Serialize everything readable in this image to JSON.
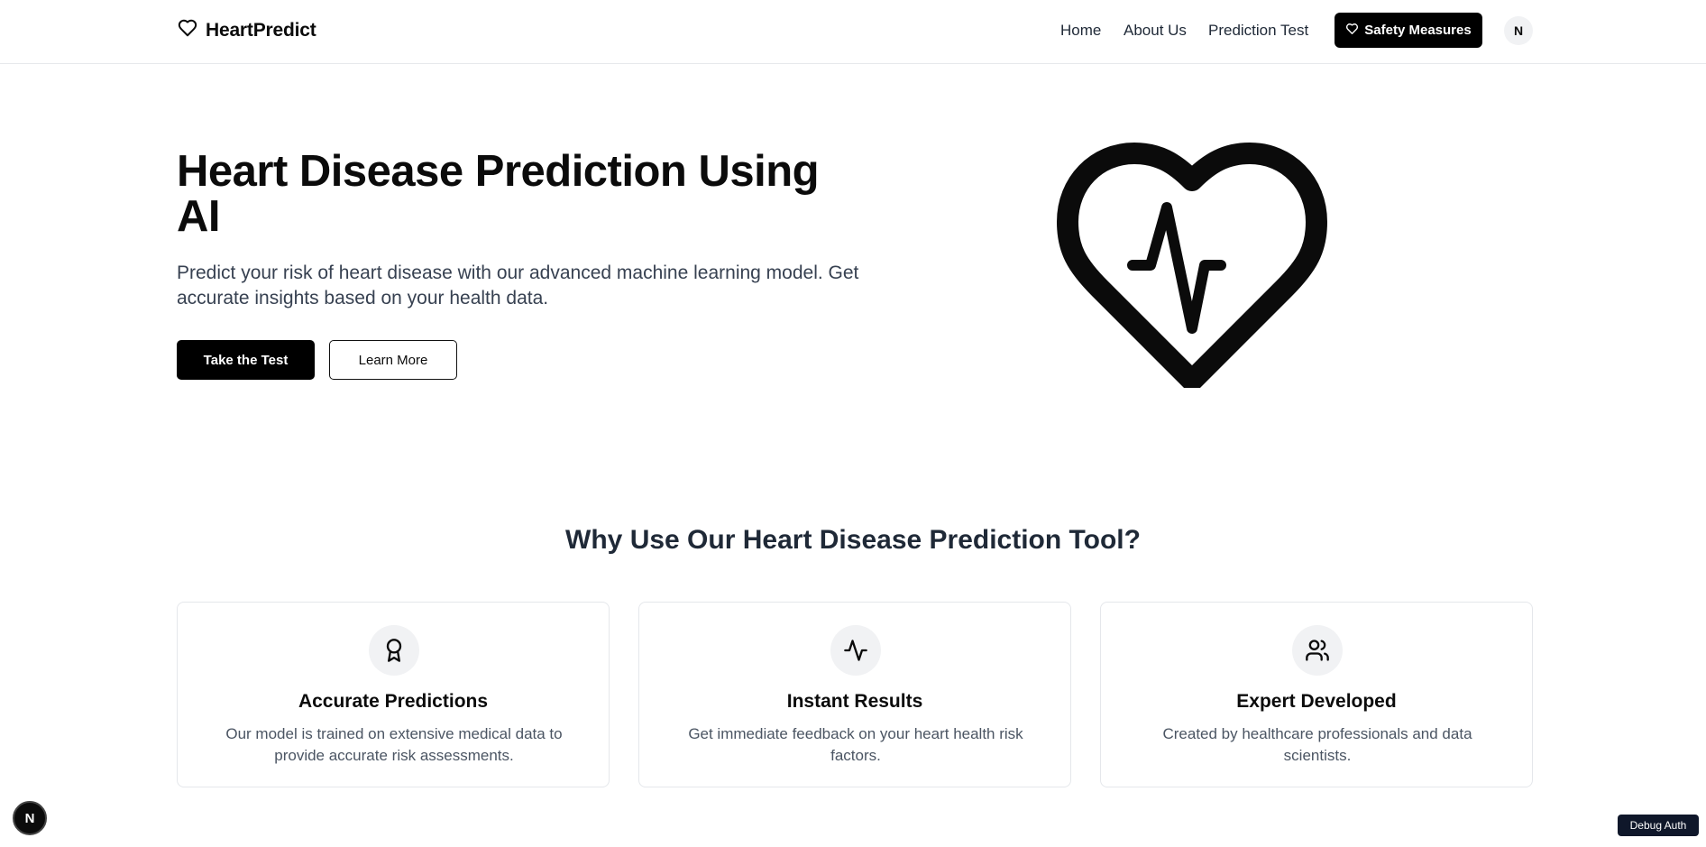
{
  "nav": {
    "brand": "HeartPredict",
    "links": [
      "Home",
      "About Us",
      "Prediction Test"
    ],
    "safety_label": "Safety Measures",
    "avatar_initial": "N"
  },
  "hero": {
    "title": "Heart Disease Prediction Using AI",
    "subtitle": "Predict your risk of heart disease with our advanced machine learning model. Get accurate insights based on your health data.",
    "primary_button": "Take the Test",
    "secondary_button": "Learn More"
  },
  "features": {
    "title": "Why Use Our Heart Disease Prediction Tool?",
    "cards": [
      {
        "title": "Accurate Predictions",
        "description": "Our model is trained on extensive medical data to provide accurate risk assessments.",
        "icon": "award-icon"
      },
      {
        "title": "Instant Results",
        "description": "Get immediate feedback on your heart health risk factors.",
        "icon": "activity-icon"
      },
      {
        "title": "Expert Developed",
        "description": "Created by healthcare professionals and data scientists.",
        "icon": "users-icon"
      }
    ]
  },
  "overlays": {
    "next_badge": "N",
    "debug_label": "Debug Auth"
  },
  "colors": {
    "primary": "#000000",
    "heading": "#1f2937",
    "muted_text": "#4b5563",
    "border": "#e5e7eb",
    "icon_bg": "#f1f2f4"
  }
}
